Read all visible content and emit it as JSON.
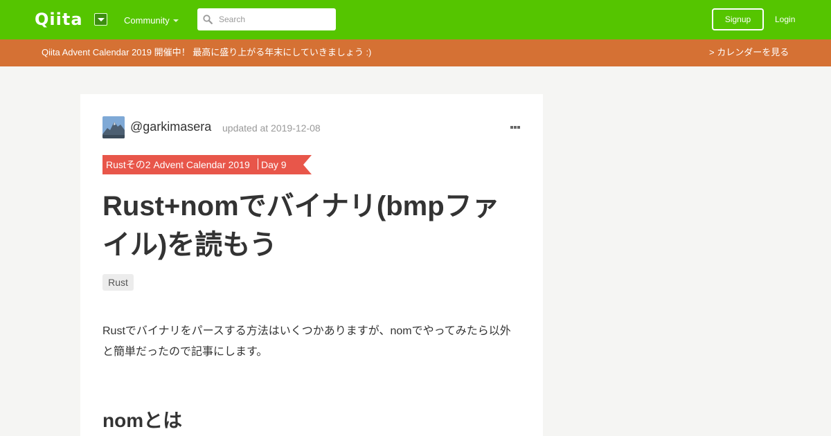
{
  "header": {
    "logo": "Qiita",
    "community_label": "Community",
    "search_placeholder": "Search",
    "signup_label": "Signup",
    "login_label": "Login",
    "brand_color": "#55c500"
  },
  "banner": {
    "text": "Qiita Advent Calendar 2019 開催中！ 最高に盛り上がる年末にしていきましょう :)",
    "link": "> カレンダーを見る",
    "color": "#d57134"
  },
  "article": {
    "author": "@garkimasera",
    "updated": "updated at 2019-12-08",
    "calendar_name": "Rustその2 Advent Calendar 2019",
    "calendar_day": "Day 9",
    "ribbon_color": "#e8564a",
    "title": "Rust+nomでバイナリ(bmpファイル)を読もう",
    "tags": [
      "Rust"
    ],
    "intro": "Rustでバイナリをパースする方法はいくつかありますが、nomでやってみたら以外と簡単だったので記事にします。",
    "section_heading": "nomとは"
  }
}
